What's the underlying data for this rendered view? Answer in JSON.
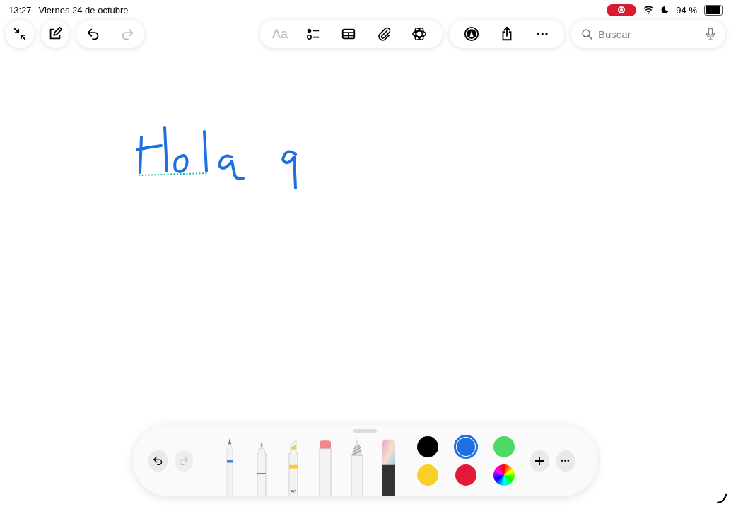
{
  "status_bar": {
    "time": "13:27",
    "date": "Viernes 24 de octubre",
    "recording": true,
    "battery": "94 %"
  },
  "toolbar": {
    "left": [
      {
        "kind": "collapse"
      },
      {
        "kind": "compose"
      }
    ],
    "history": [
      {
        "kind": "undo",
        "disabled": false
      },
      {
        "kind": "redo",
        "disabled": true
      }
    ],
    "format": {
      "label": "Aa",
      "disabled": true
    },
    "tools": [
      {
        "kind": "checklist"
      },
      {
        "kind": "table"
      },
      {
        "kind": "attach"
      },
      {
        "kind": "atom"
      }
    ],
    "actions": [
      {
        "kind": "markup"
      },
      {
        "kind": "share"
      },
      {
        "kind": "more"
      }
    ],
    "search": {
      "placeholder": "Buscar"
    }
  },
  "palette": {
    "history": [
      {
        "kind": "undo",
        "disabled": false
      },
      {
        "kind": "redo",
        "disabled": true
      }
    ],
    "tools": [
      {
        "kind": "pen",
        "selected": false
      },
      {
        "kind": "fineliner",
        "selected": false
      },
      {
        "kind": "highlighter",
        "selected": false,
        "label": "80"
      },
      {
        "kind": "eraser",
        "selected": false
      },
      {
        "kind": "pencil",
        "selected": false
      },
      {
        "kind": "crayon",
        "selected": false
      }
    ],
    "colors": [
      {
        "color": "#000000",
        "selected": false
      },
      {
        "color": "#1e6fe0",
        "selected": true
      },
      {
        "color": "#4cd964",
        "selected": false
      },
      {
        "color": "#f9cf2a",
        "selected": false
      },
      {
        "color": "#e5173a",
        "selected": false
      },
      {
        "kind": "wheel",
        "selected": false
      }
    ]
  }
}
